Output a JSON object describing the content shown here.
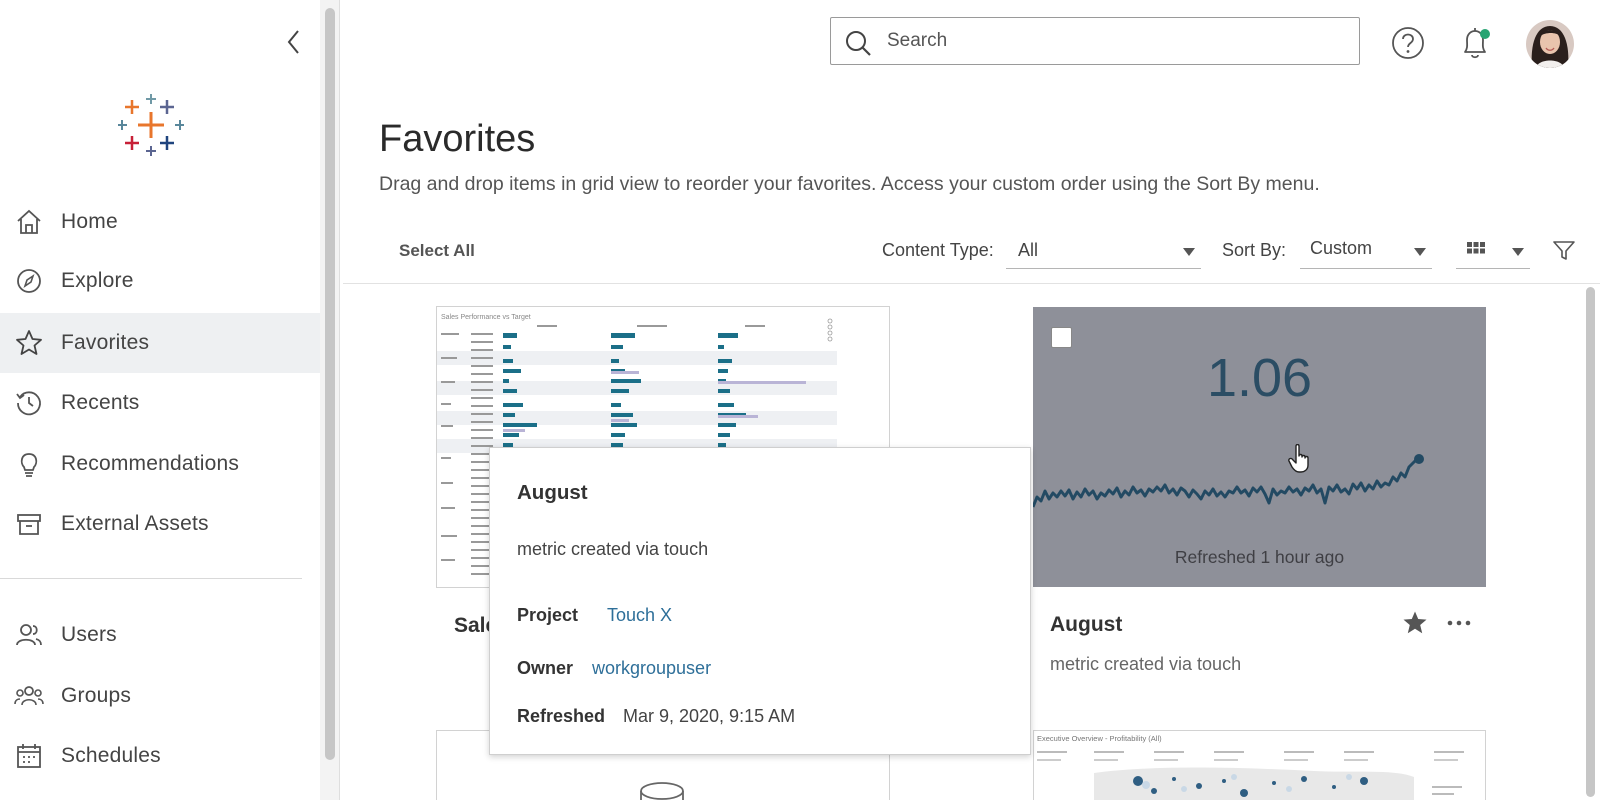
{
  "sidebar": {
    "items": [
      {
        "label": "Home",
        "icon": "home-icon"
      },
      {
        "label": "Explore",
        "icon": "compass-icon"
      },
      {
        "label": "Favorites",
        "icon": "star-icon",
        "active": true
      },
      {
        "label": "Recents",
        "icon": "history-icon"
      },
      {
        "label": "Recommendations",
        "icon": "lightbulb-icon"
      },
      {
        "label": "External Assets",
        "icon": "archive-box-icon"
      },
      {
        "label": "Users",
        "icon": "users-icon"
      },
      {
        "label": "Groups",
        "icon": "groups-icon"
      },
      {
        "label": "Schedules",
        "icon": "calendar-icon"
      }
    ]
  },
  "header": {
    "search_placeholder": "Search",
    "notification_dot_color": "#27a472"
  },
  "page": {
    "title": "Favorites",
    "subtitle": "Drag and drop items in grid view to reorder your favorites. Access your custom order using the Sort By menu."
  },
  "toolbar": {
    "select_all": "Select All",
    "content_type_label": "Content Type:",
    "content_type_value": "All",
    "sort_by_label": "Sort By:",
    "sort_by_value": "Custom"
  },
  "cards": [
    {
      "title": "Sale",
      "thumbnail_title": "Sales Performance vs Target"
    },
    {
      "title": "August",
      "description": "metric created via touch",
      "metric_value": "1.06",
      "refreshed": "Refreshed 1 hour ago",
      "favorited": true
    },
    {
      "thumbnail_title": "Executive Overview - Profitability (All)"
    }
  ],
  "tooltip": {
    "title": "August",
    "description": "metric created via touch",
    "project_label": "Project",
    "project_value": "Touch X",
    "owner_label": "Owner",
    "owner_value": "workgroupuser",
    "refreshed_label": "Refreshed",
    "refreshed_value": "Mar 9, 2020, 9:15 AM"
  },
  "colors": {
    "accent_link": "#2e6f99",
    "metric_bg": "#8e9099",
    "metric_value": "#2b4d64",
    "sparkline": "#234a63"
  }
}
